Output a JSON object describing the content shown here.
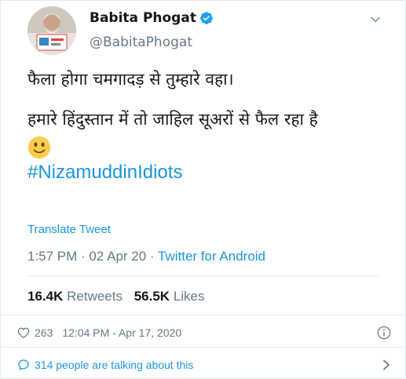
{
  "tweet": {
    "author": {
      "display_name": "Babita Phogat",
      "handle": "@BabitaPhogat",
      "verified": true
    },
    "text_lines": [
      "फैला होगा चमगादड़ से तुम्हारे वहा।",
      "हमारे हिंदुस्तान में तो जाहिल सूअरों से फैल रहा है"
    ],
    "emoji": "slightly-smiling-face",
    "hashtag": "#NizamuddinIdiots",
    "translate_label": "Translate Tweet",
    "timestamp": "1:57 PM · 02 Apr 20 · ",
    "source": "Twitter for Android",
    "retweets": {
      "count": "16.4K",
      "label": "Retweets"
    },
    "likes": {
      "count": "56.5K",
      "label": "Likes"
    }
  },
  "embed_footer": {
    "like_count": "263",
    "timestamp": "12:04 PM - Apr 17, 2020",
    "conversation_label": "314 people are talking about this"
  },
  "colors": {
    "link_blue": "#1b95e0",
    "muted_gray": "#657786",
    "text_dark": "#14171a",
    "border": "#e1e8ed"
  }
}
